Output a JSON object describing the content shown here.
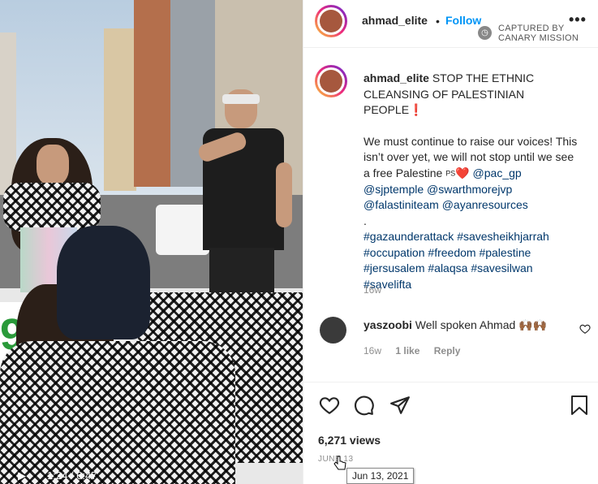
{
  "post": {
    "username": "ahmad_elite",
    "dot": "•",
    "follow_label": "Follow",
    "more_label": "•••",
    "watermark_line1": "CAPTURED BY",
    "watermark_line2": "CANARY MISSION"
  },
  "caption": {
    "username": "ahmad_elite",
    "headline": "STOP THE ETHNIC CLEANSING OF PALESTINIAN PEOPLE",
    "headline_mark": "❗",
    "body": "We must continue to raise our voices! This isn’t over yet, we will not stop until we see a free Palestine",
    "ps": "PS",
    "heart": "❤️",
    "mentions": [
      "@pac_gp",
      "@sjptemple",
      "@swarthmorejvp",
      "@falastiniteam",
      "@ayanresources"
    ],
    "separator": ".",
    "hashtags": [
      "#gazaunderattack",
      "#savesheikhjarrah",
      "#occupation",
      "#freedom",
      "#palestine",
      "#jersusalem",
      "#alaqsa",
      "#savesilwan",
      "#savelifta"
    ],
    "age": "16w"
  },
  "comment": {
    "username": "yaszoobi",
    "text": "Well spoken Ahmad 🙌🏾🙌🏾",
    "age": "16w",
    "likes": "1 like",
    "reply": "Reply"
  },
  "stats": {
    "views": "6,271 views",
    "date": "JUNE 13",
    "tooltip": "Jun 13, 2021"
  },
  "video": {
    "time": "1:24 / 6:47",
    "sign_text": "99"
  },
  "colors": {
    "follow": "#0095f6",
    "link": "#00376b",
    "muted": "#8e8e8e"
  }
}
